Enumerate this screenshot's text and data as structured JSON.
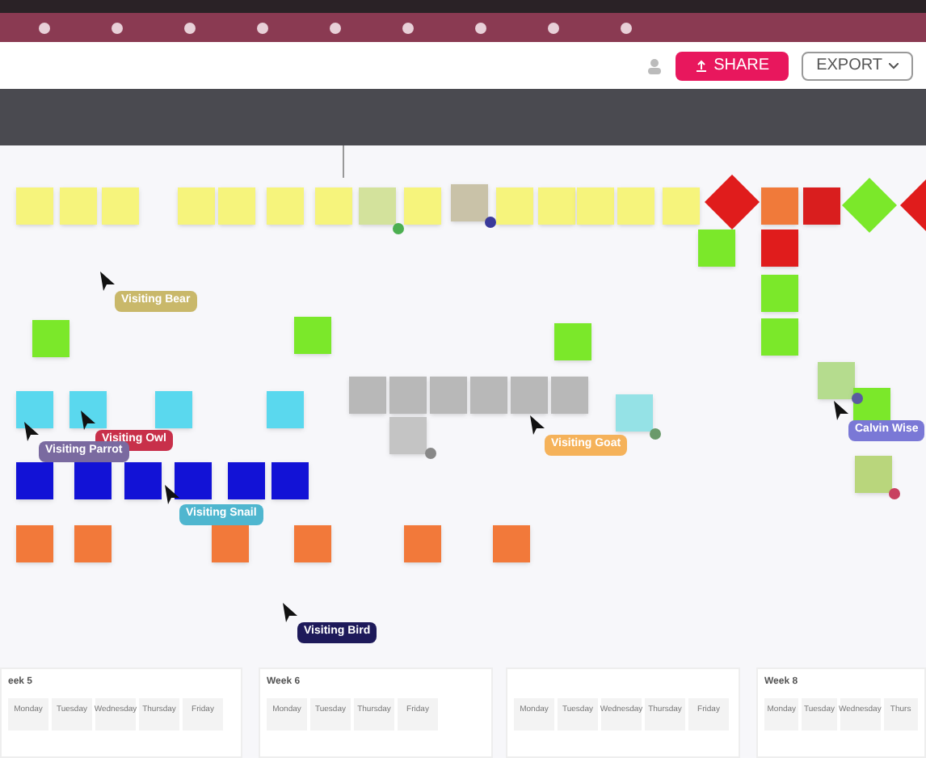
{
  "toolbar": {
    "share": "SHARE",
    "export": "EXPORT"
  },
  "notes": [
    {
      "kind": "sticky",
      "color": "#f6f47c"
    },
    {
      "kind": "sticky",
      "color": "#f6f47c"
    },
    {
      "kind": "sticky",
      "color": "#f6f47c"
    },
    {
      "kind": "sticky",
      "color": "#f6f47c"
    },
    {
      "kind": "sticky",
      "color": "#f6f47c"
    },
    {
      "kind": "sticky",
      "color": "#f6f47c"
    },
    {
      "kind": "sticky",
      "color": "#f6f47c"
    },
    {
      "kind": "sticky",
      "color": "#d3e29c"
    },
    {
      "kind": "sticky",
      "color": "#f6f47c"
    },
    {
      "kind": "sticky",
      "color": "#c9c2a8"
    },
    {
      "kind": "sticky",
      "color": "#f6f47c"
    },
    {
      "kind": "sticky",
      "color": "#f6f47c"
    },
    {
      "kind": "sticky",
      "color": "#f6f47c"
    },
    {
      "kind": "sticky",
      "color": "#f6f47c"
    },
    {
      "kind": "sticky",
      "color": "#f6f47c"
    },
    {
      "kind": "diamond",
      "color": "#e01c1c"
    },
    {
      "kind": "sticky",
      "color": "#f07a3a"
    },
    {
      "kind": "sticky",
      "color": "#d91e1e"
    },
    {
      "kind": "diamond",
      "color": "#7be82a"
    },
    {
      "kind": "diamond",
      "color": "#e01c1c"
    },
    {
      "kind": "sticky",
      "color": "#7be82a"
    },
    {
      "kind": "sticky",
      "color": "#e01c1c"
    },
    {
      "kind": "sticky",
      "color": "#7be82a"
    },
    {
      "kind": "sticky",
      "color": "#7be82a"
    },
    {
      "kind": "sticky",
      "color": "#b5dc8e"
    },
    {
      "kind": "sticky",
      "color": "#7be82a"
    },
    {
      "kind": "sticky",
      "color": "#b9d67c"
    },
    {
      "kind": "sticky",
      "color": "#7be82a"
    },
    {
      "kind": "sticky",
      "color": "#7be82a"
    },
    {
      "kind": "sticky",
      "color": "#7be82a"
    },
    {
      "kind": "sticky",
      "color": "#5ad8ee"
    },
    {
      "kind": "sticky",
      "color": "#5ad8ee"
    },
    {
      "kind": "sticky",
      "color": "#5ad8ee"
    },
    {
      "kind": "sticky",
      "color": "#5ad8ee"
    },
    {
      "kind": "sticky",
      "color": "#95e2e6"
    },
    {
      "kind": "sticky",
      "color": "#b8b8b8"
    },
    {
      "kind": "sticky",
      "color": "#b8b8b8"
    },
    {
      "kind": "sticky",
      "color": "#b8b8b8"
    },
    {
      "kind": "sticky",
      "color": "#b8b8b8"
    },
    {
      "kind": "sticky",
      "color": "#b8b8b8"
    },
    {
      "kind": "sticky",
      "color": "#b8b8b8"
    },
    {
      "kind": "sticky",
      "color": "#c4c4c4"
    },
    {
      "kind": "sticky",
      "color": "#1212d6"
    },
    {
      "kind": "sticky",
      "color": "#1212d6"
    },
    {
      "kind": "sticky",
      "color": "#1212d6"
    },
    {
      "kind": "sticky",
      "color": "#1212d6"
    },
    {
      "kind": "sticky",
      "color": "#1212d6"
    },
    {
      "kind": "sticky",
      "color": "#1212d6"
    },
    {
      "kind": "sticky",
      "color": "#f2793a"
    },
    {
      "kind": "sticky",
      "color": "#f2793a"
    },
    {
      "kind": "sticky",
      "color": "#f2793a"
    },
    {
      "kind": "sticky",
      "color": "#f2793a"
    },
    {
      "kind": "sticky",
      "color": "#f2793a"
    },
    {
      "kind": "sticky",
      "color": "#f2793a"
    }
  ],
  "cursors": [
    {
      "label": "Visiting Bear",
      "color": "#c9b86a"
    },
    {
      "label": "Visiting Owl",
      "color": "#c8304a"
    },
    {
      "label": "Visiting Parrot",
      "color": "#7a6aa0"
    },
    {
      "label": "Visiting Snail",
      "color": "#4fb6cf"
    },
    {
      "label": "Visiting Bird",
      "color": "#1e1a5a"
    },
    {
      "label": "Visiting Goat",
      "color": "#f5b25a"
    },
    {
      "label": "Calvin Wise",
      "color": "#7a78d6"
    }
  ],
  "weeks": [
    {
      "title": "eek 5",
      "days": [
        "Monday",
        "Tuesday",
        "Wednesday",
        "Thursday",
        "Friday"
      ]
    },
    {
      "title": "Week 6",
      "days": [
        "Monday",
        "Tuesday",
        "Thursday",
        "Friday"
      ]
    },
    {
      "days": [
        "Monday",
        "Tuesday",
        "Wednesday",
        "Thursday",
        "Friday"
      ]
    },
    {
      "title": "Week 8",
      "days": [
        "Monday",
        "Tuesday",
        "Wednesday",
        "Thurs"
      ]
    }
  ]
}
